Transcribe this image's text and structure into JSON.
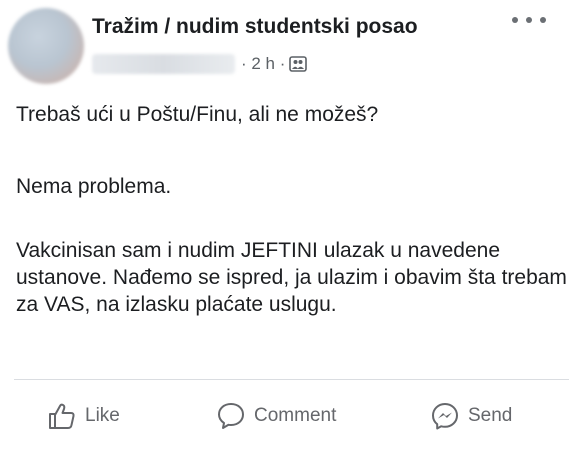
{
  "post": {
    "group_name": "Tražim / nudim studentski posao",
    "time": "· 2 h ·",
    "paragraphs": [
      "Trebaš ući u Poštu/Finu, ali ne možeš?",
      "Nema problema.",
      "Vakcinisan sam i nudim JEFTINI ulazak u navedene ustanove. Nađemo se ispred, ja ulazim i obavim šta trebam za VAS, na izlasku plaćate uslugu."
    ]
  },
  "actions": {
    "like_label": "Like",
    "comment_label": "Comment",
    "send_label": "Send"
  },
  "icons": {
    "more": "more-icon",
    "privacy": "group-privacy-icon",
    "like": "thumbs-up-icon",
    "comment": "comment-bubble-icon",
    "send": "messenger-icon"
  },
  "colors": {
    "text": "#1c1e21",
    "secondary": "#65676b",
    "divider": "#dadde1"
  }
}
